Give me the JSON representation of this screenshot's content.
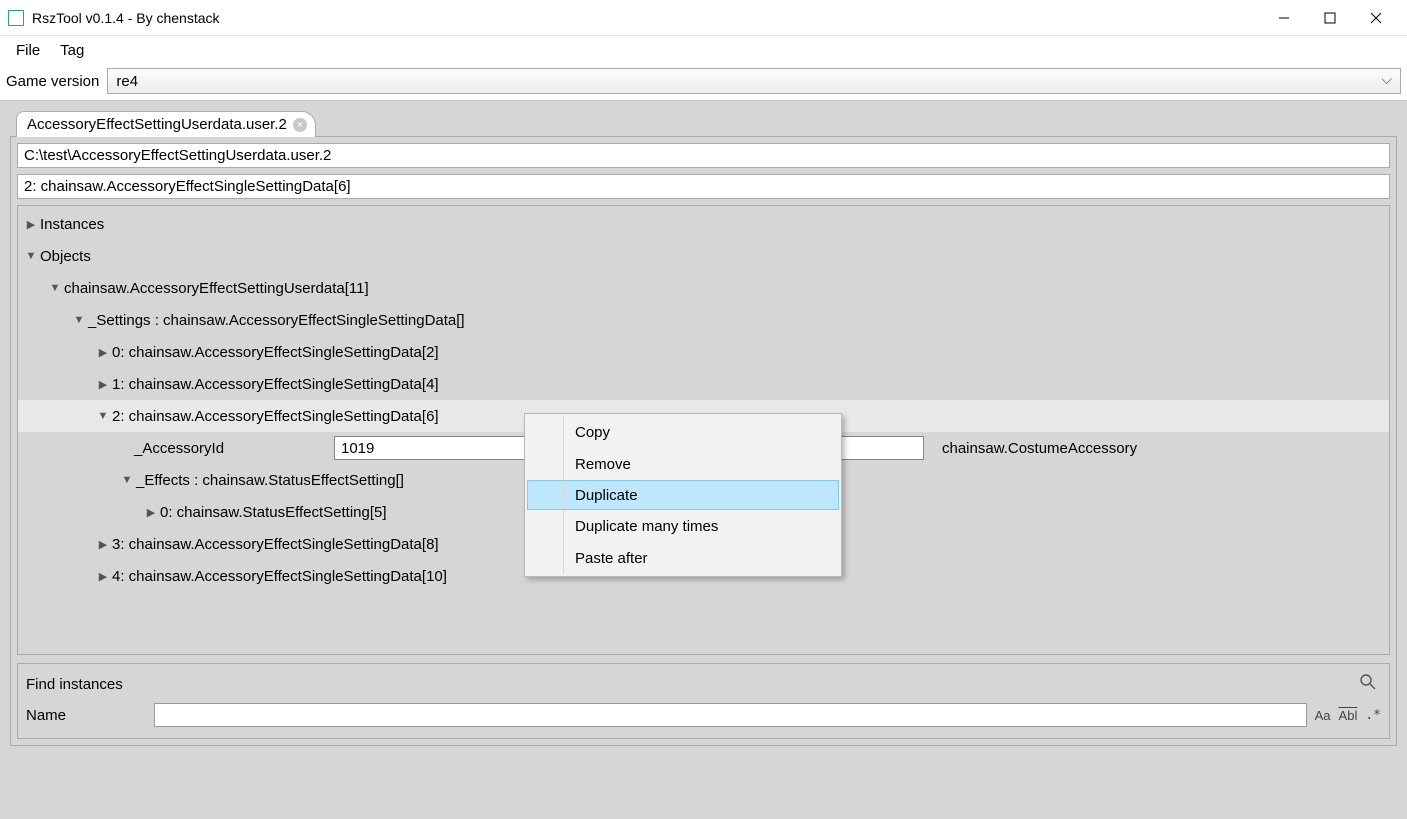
{
  "window": {
    "title": "RszTool v0.1.4 - By chenstack"
  },
  "menu": {
    "file": "File",
    "tag": "Tag"
  },
  "toolbar": {
    "game_version_label": "Game version",
    "game_version_value": "re4"
  },
  "tab": {
    "label": "AccessoryEffectSettingUserdata.user.2"
  },
  "path": "C:\\test\\AccessoryEffectSettingUserdata.user.2",
  "breadcrumb": "2: chainsaw.AccessoryEffectSingleSettingData[6]",
  "tree": {
    "instances": "Instances",
    "objects": "Objects",
    "root": "chainsaw.AccessoryEffectSettingUserdata[11]",
    "settings": "_Settings : chainsaw.AccessoryEffectSingleSettingData[]",
    "item0": "0: chainsaw.AccessoryEffectSingleSettingData[2]",
    "item1": "1: chainsaw.AccessoryEffectSingleSettingData[4]",
    "item2": "2: chainsaw.AccessoryEffectSingleSettingData[6]",
    "accessory_field": "_AccessoryId",
    "accessory_value": "1019",
    "accessory_type": "chainsaw.CostumeAccessory",
    "effects": "_Effects : chainsaw.StatusEffectSetting[]",
    "effects0": "0: chainsaw.StatusEffectSetting[5]",
    "item3": "3: chainsaw.AccessoryEffectSingleSettingData[8]",
    "item4": "4: chainsaw.AccessoryEffectSingleSettingData[10]"
  },
  "context": {
    "copy": "Copy",
    "remove": "Remove",
    "duplicate": "Duplicate",
    "duplicate_many": "Duplicate many times",
    "paste_after": "Paste after"
  },
  "find": {
    "title": "Find instances",
    "name_label": "Name",
    "aa": "Aa",
    "abl": "Abl",
    "regex": ".*"
  }
}
